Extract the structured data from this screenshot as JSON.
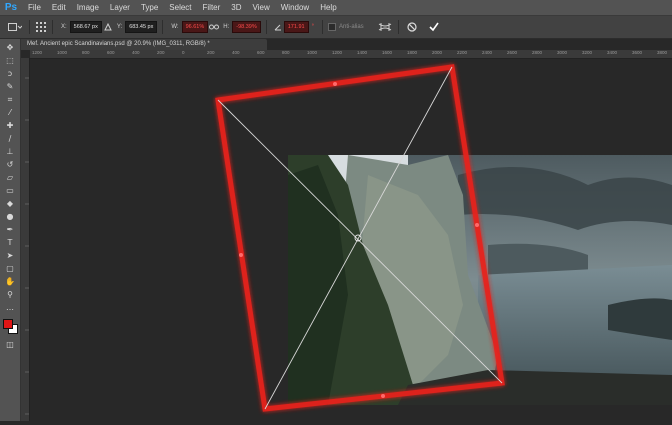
{
  "app": {
    "logo": "Ps"
  },
  "menu": [
    "File",
    "Edit",
    "Image",
    "Layer",
    "Type",
    "Select",
    "Filter",
    "3D",
    "View",
    "Window",
    "Help"
  ],
  "options": {
    "x_label": "X:",
    "x_value": "568.67 px",
    "y_label": "Y:",
    "y_value": "683.45 px",
    "w_label": "W:",
    "w_value": "96.61%",
    "h_label": "H:",
    "h_value": "-98.39%",
    "angle_value": "171.91",
    "angle_unit": "°",
    "antialias_label": "Anti-alias"
  },
  "document": {
    "tab_title": "Mef. Ancient epic Scandinavians.psd @ 20.9% (IMG_0311, RGB/8) *"
  },
  "ruler": {
    "ticks": [
      "1200",
      "1000",
      "800",
      "600",
      "400",
      "200",
      "0",
      "200",
      "400",
      "600",
      "800",
      "1000",
      "1200",
      "1400",
      "1600",
      "1800",
      "2000",
      "2200",
      "2400",
      "2600",
      "2800",
      "3000",
      "3200",
      "3400",
      "3600",
      "3800"
    ]
  },
  "colors": {
    "foreground": "#e01616",
    "background": "#ffffff",
    "transform_box": "#e8201c"
  }
}
